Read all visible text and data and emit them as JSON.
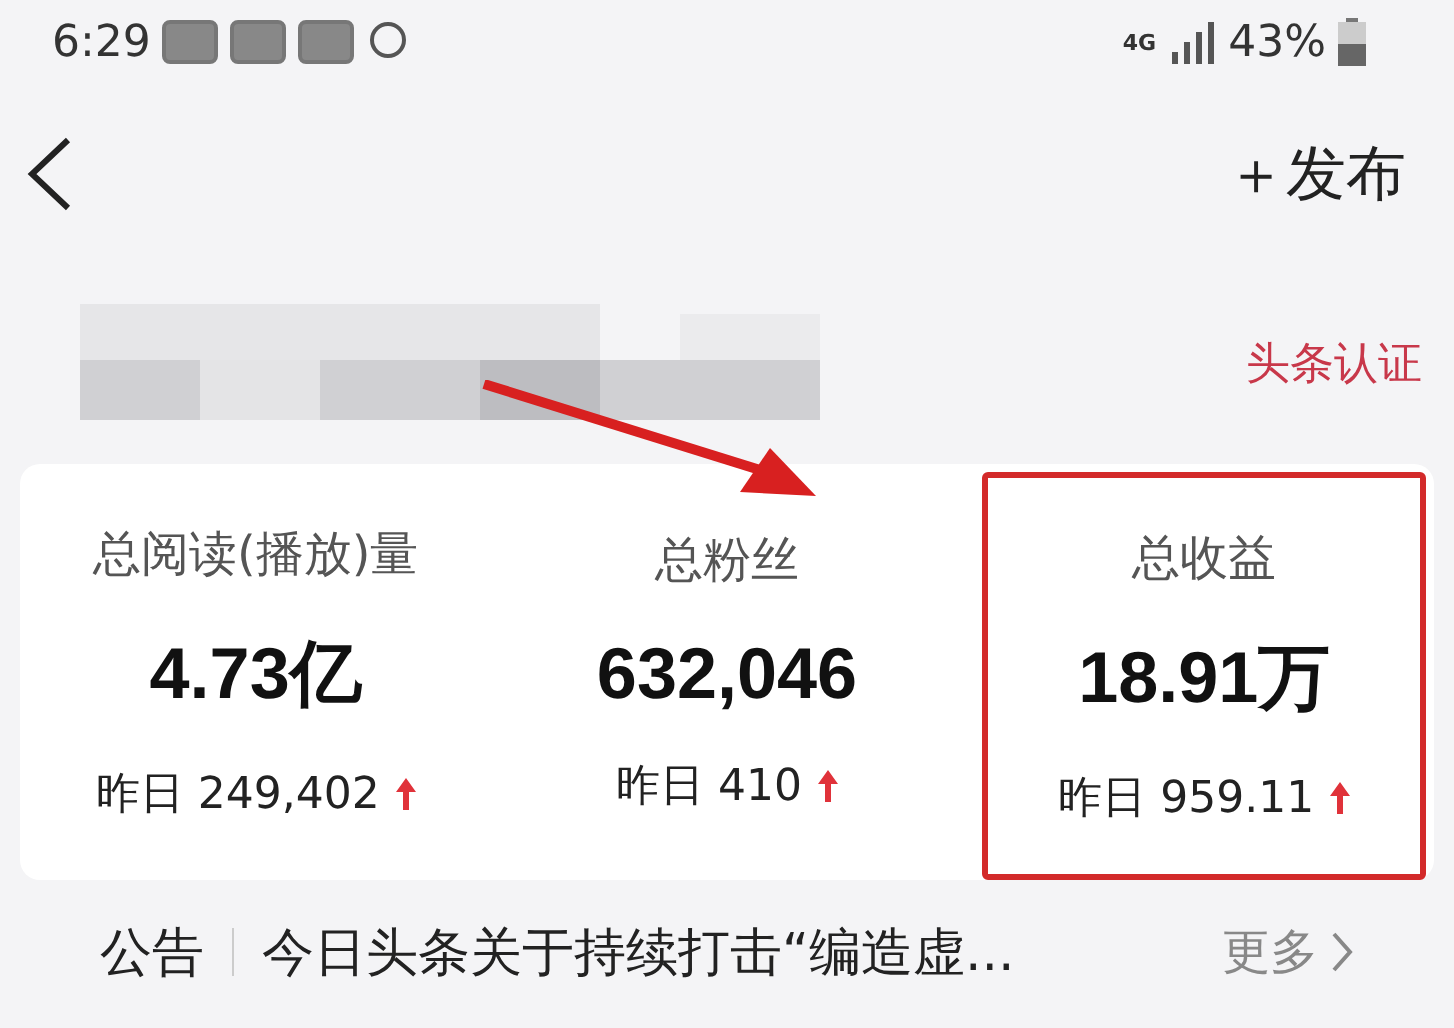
{
  "status_bar": {
    "time": "6:29",
    "battery": "43%",
    "network": "4G"
  },
  "header": {
    "publish": "＋发布"
  },
  "profile": {
    "badge": "头条认证"
  },
  "stats": [
    {
      "label": "总阅读(播放)量",
      "value": "4.73亿",
      "yesterday": "昨日 249,402",
      "up": true,
      "highlighted": false
    },
    {
      "label": "总粉丝",
      "value": "632,046",
      "yesterday": "昨日 410",
      "up": true,
      "highlighted": false
    },
    {
      "label": "总收益",
      "value": "18.91万",
      "yesterday": "昨日 959.11",
      "up": true,
      "highlighted": true
    }
  ],
  "notice": {
    "label": "公告",
    "text": "今日头条关于持续打击“编造虚...",
    "more": "更多"
  }
}
